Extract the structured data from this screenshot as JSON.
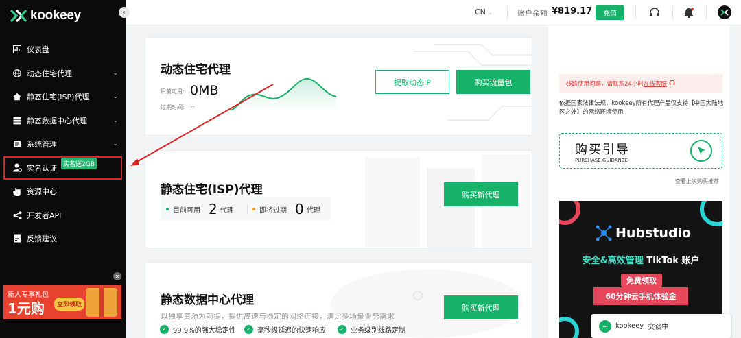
{
  "brand": {
    "name": "kookeey"
  },
  "sidebar": {
    "items": [
      {
        "label": "仪表盘",
        "icon": "dashboard-icon",
        "has_caret": false
      },
      {
        "label": "动态住宅代理",
        "icon": "globe-icon",
        "has_caret": true
      },
      {
        "label": "静态住宅(ISP)代理",
        "icon": "home-icon",
        "has_caret": true
      },
      {
        "label": "静态数据中心代理",
        "icon": "server-icon",
        "has_caret": true
      },
      {
        "label": "系统管理",
        "icon": "settings-icon",
        "has_caret": true
      },
      {
        "label": "实名认证",
        "icon": "user-verify-icon",
        "has_caret": false,
        "badge": "实名送2GB"
      },
      {
        "label": "资源中心",
        "icon": "hand-icon",
        "has_caret": false
      },
      {
        "label": "开发者API",
        "icon": "api-icon",
        "has_caret": false
      },
      {
        "label": "反馈建议",
        "icon": "feedback-icon",
        "has_caret": false
      }
    ],
    "promo": {
      "line1": "新人专享礼包",
      "big": "1元购",
      "button": "立即领取"
    }
  },
  "topbar": {
    "language": "CN",
    "balance_label": "账户余额",
    "balance_value": "¥819.17",
    "recharge_label": "充值"
  },
  "dynamic_card": {
    "title": "动态住宅代理",
    "available_label": "目前可用:",
    "available_value": "0MB",
    "expire_label": "过期时间:",
    "expire_value": "--",
    "extract_button": "提取动态IP",
    "buy_button": "购买流量包"
  },
  "isp_card": {
    "title": "静态住宅(ISP)代理",
    "available_label": "目前可用",
    "available_count": "2",
    "expiring_label": "即将过期",
    "expiring_count": "0",
    "unit": "代理",
    "buy_button": "购买新代理"
  },
  "dc_card": {
    "title": "静态数据中心代理",
    "description": "以独享资源为前提，提供高速与稳定的网络连接，满足多场景业务需求",
    "buy_button": "购买新代理",
    "features": [
      "99.9%的强大稳定性",
      "毫秒级延迟的快速响应",
      "业务级别线路定制"
    ]
  },
  "right_panel": {
    "notice_text": "线路使用问题，请联系24小时",
    "notice_link": "在线客服",
    "law_text": "依据国家法律法规，kookeey所有代理产品仅支持【中国大陆地区之外】的网络环境使用",
    "guide_title": "购买引导",
    "guide_sub": "PURCHASE GUIDANCE",
    "recommend_link": "查看上次购买推荐",
    "ad": {
      "logo": "Hubstudio",
      "headline": "安全&高效管理",
      "platform": "TikTok 账户",
      "button": "免费领取",
      "offer": "60分钟云手机体验金"
    }
  },
  "chat": {
    "name": "kookeey",
    "status": "交谈中"
  },
  "colors": {
    "accent": "#17b26a",
    "sidebar_bg": "#0b0b0b",
    "alert": "#e02020"
  }
}
